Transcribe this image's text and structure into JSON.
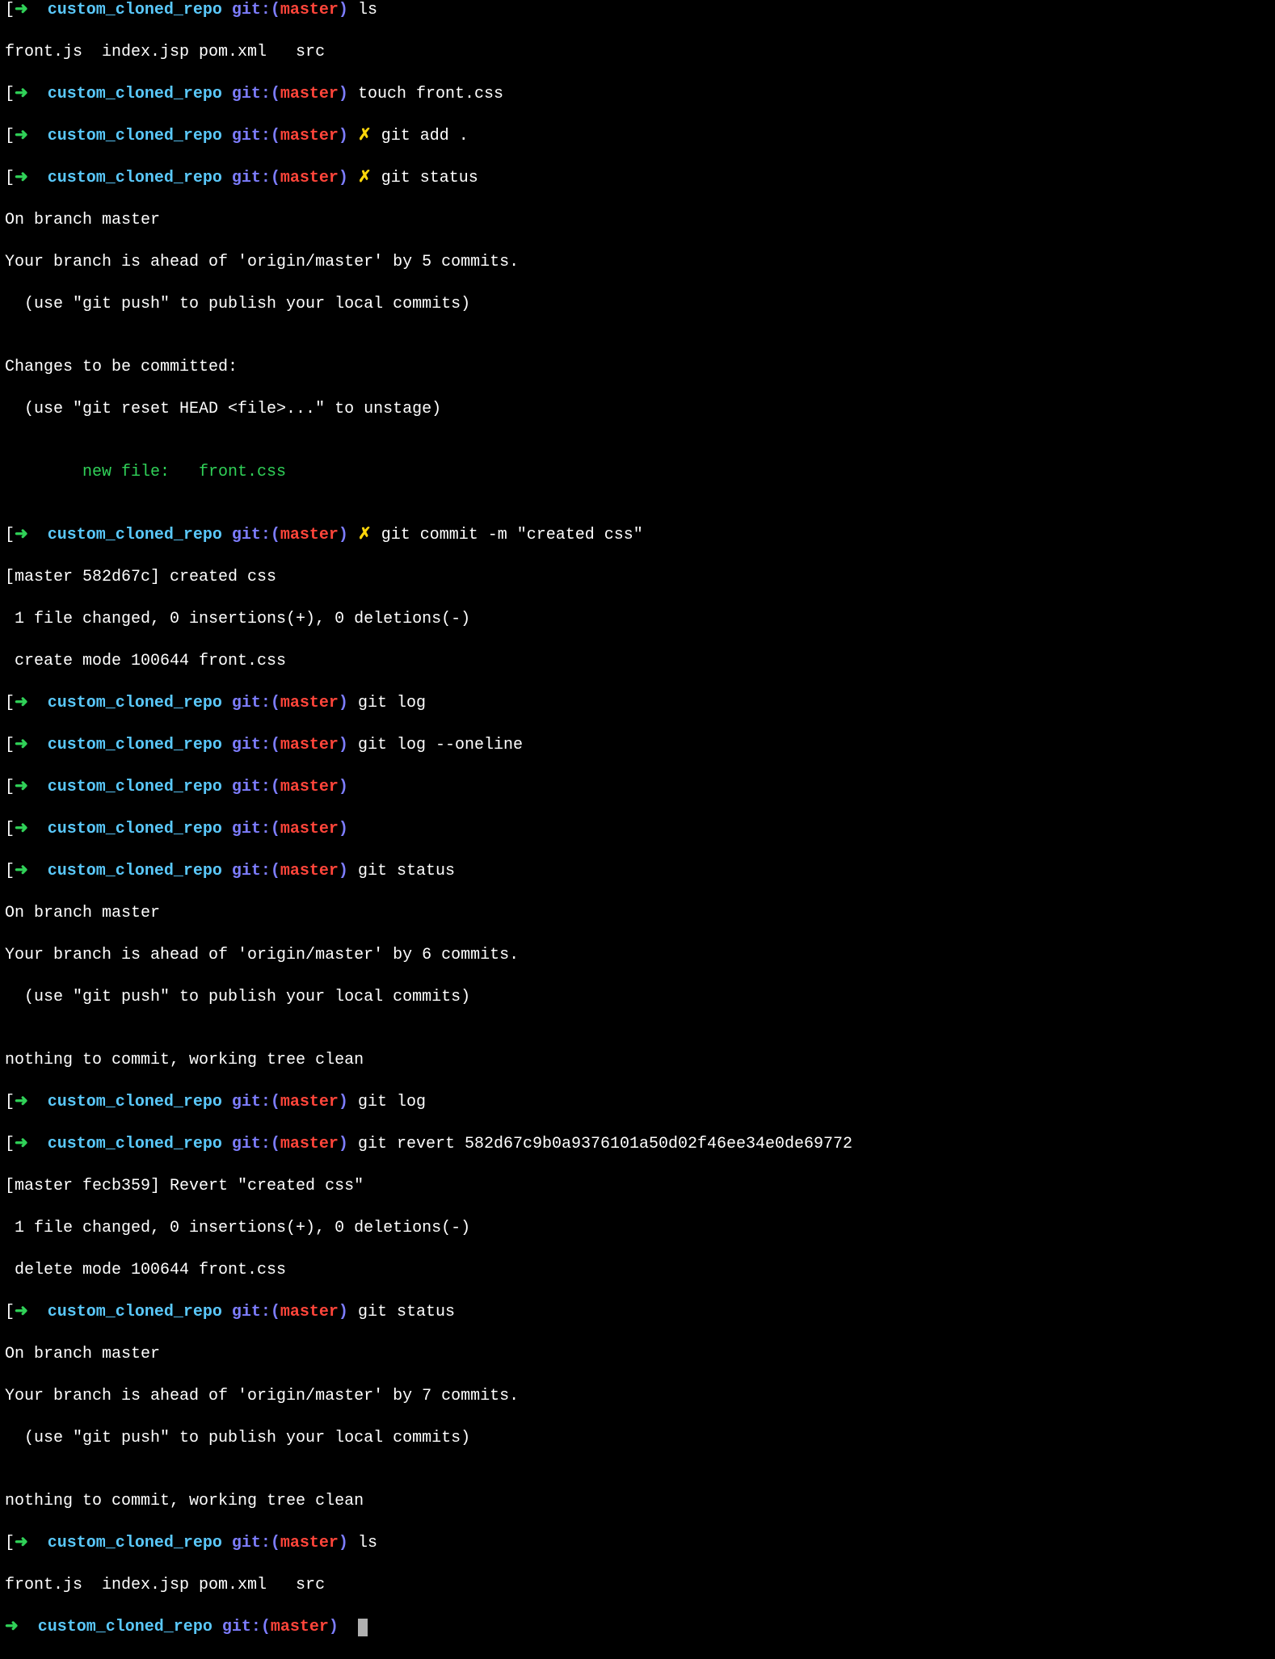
{
  "prompt": {
    "arrow": "➜",
    "dir": "custom_cloned_repo",
    "git_word": "git:",
    "paren_open": "(",
    "paren_close": ")",
    "branch": "master",
    "dirty": "✗"
  },
  "lines": [
    {
      "type": "prompt",
      "dirty": false,
      "cmd": "ls"
    },
    {
      "type": "out",
      "text": "front.js  index.jsp pom.xml   src"
    },
    {
      "type": "prompt",
      "dirty": false,
      "cmd": "touch front.css"
    },
    {
      "type": "prompt",
      "dirty": true,
      "cmd": "git add ."
    },
    {
      "type": "prompt",
      "dirty": true,
      "cmd": "git status"
    },
    {
      "type": "out",
      "text": "On branch master"
    },
    {
      "type": "out",
      "text": "Your branch is ahead of 'origin/master' by 5 commits."
    },
    {
      "type": "out",
      "text": "  (use \"git push\" to publish your local commits)"
    },
    {
      "type": "out",
      "text": ""
    },
    {
      "type": "out",
      "text": "Changes to be committed:"
    },
    {
      "type": "out",
      "text": "  (use \"git reset HEAD <file>...\" to unstage)"
    },
    {
      "type": "out",
      "text": ""
    },
    {
      "type": "green",
      "text": "        new file:   front.css"
    },
    {
      "type": "out",
      "text": ""
    },
    {
      "type": "prompt",
      "dirty": true,
      "cmd": "git commit -m \"created css\""
    },
    {
      "type": "out",
      "text": "[master 582d67c] created css"
    },
    {
      "type": "out",
      "text": " 1 file changed, 0 insertions(+), 0 deletions(-)"
    },
    {
      "type": "out",
      "text": " create mode 100644 front.css"
    },
    {
      "type": "prompt",
      "dirty": false,
      "cmd": "git log"
    },
    {
      "type": "prompt",
      "dirty": false,
      "cmd": "git log --oneline"
    },
    {
      "type": "prompt",
      "dirty": false,
      "cmd": ""
    },
    {
      "type": "prompt",
      "dirty": false,
      "cmd": ""
    },
    {
      "type": "prompt",
      "dirty": false,
      "cmd": "git status"
    },
    {
      "type": "out",
      "text": "On branch master"
    },
    {
      "type": "out",
      "text": "Your branch is ahead of 'origin/master' by 6 commits."
    },
    {
      "type": "out",
      "text": "  (use \"git push\" to publish your local commits)"
    },
    {
      "type": "out",
      "text": ""
    },
    {
      "type": "out",
      "text": "nothing to commit, working tree clean"
    },
    {
      "type": "prompt",
      "dirty": false,
      "cmd": "git log"
    },
    {
      "type": "prompt",
      "dirty": false,
      "cmd": "git revert 582d67c9b0a9376101a50d02f46ee34e0de69772"
    },
    {
      "type": "out",
      "text": "[master fecb359] Revert \"created css\""
    },
    {
      "type": "out",
      "text": " 1 file changed, 0 insertions(+), 0 deletions(-)"
    },
    {
      "type": "out",
      "text": " delete mode 100644 front.css"
    },
    {
      "type": "prompt",
      "dirty": false,
      "cmd": "git status"
    },
    {
      "type": "out",
      "text": "On branch master"
    },
    {
      "type": "out",
      "text": "Your branch is ahead of 'origin/master' by 7 commits."
    },
    {
      "type": "out",
      "text": "  (use \"git push\" to publish your local commits)"
    },
    {
      "type": "out",
      "text": ""
    },
    {
      "type": "out",
      "text": "nothing to commit, working tree clean"
    },
    {
      "type": "prompt",
      "dirty": false,
      "cmd": "ls"
    },
    {
      "type": "out",
      "text": "front.js  index.jsp pom.xml   src"
    },
    {
      "type": "prompt",
      "dirty": false,
      "cmd": "",
      "cursor": true,
      "nolbrack": true
    }
  ]
}
